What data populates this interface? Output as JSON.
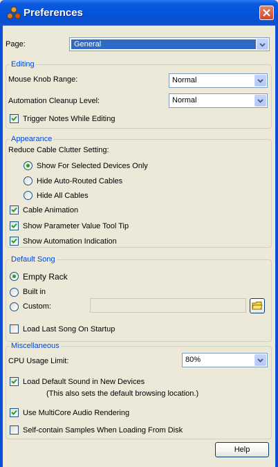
{
  "window": {
    "title": "Preferences",
    "icon": "app-logo-icon",
    "close_icon": "close-icon"
  },
  "page": {
    "label": "Page:",
    "selected": "General"
  },
  "editing": {
    "legend": "Editing",
    "mouse_knob_label": "Mouse Knob Range:",
    "mouse_knob_value": "Normal",
    "automation_label": "Automation Cleanup Level:",
    "automation_value": "Normal",
    "trigger_notes_label": "Trigger Notes While Editing",
    "trigger_notes_checked": true
  },
  "appearance": {
    "legend": "Appearance",
    "cable_clutter_label": "Reduce Cable Clutter Setting:",
    "radios": [
      {
        "label": "Show For Selected Devices Only",
        "selected": true
      },
      {
        "label": "Hide Auto-Routed Cables",
        "selected": false
      },
      {
        "label": "Hide All Cables",
        "selected": false
      }
    ],
    "checkboxes": [
      {
        "label": "Cable Animation",
        "checked": true
      },
      {
        "label": "Show Parameter Value Tool Tip",
        "checked": true
      },
      {
        "label": "Show Automation Indication",
        "checked": true
      }
    ]
  },
  "default_song": {
    "legend": "Default Song",
    "radios": [
      {
        "label": "Empty Rack",
        "selected": true
      },
      {
        "label": "Built in",
        "selected": false
      },
      {
        "label": "Custom:",
        "selected": false
      }
    ],
    "custom_value": "",
    "browse_icon": "folder-icon",
    "load_last_label": "Load Last Song On Startup",
    "load_last_checked": false
  },
  "misc": {
    "legend": "Miscellaneous",
    "cpu_label": "CPU Usage Limit:",
    "cpu_value": "80%",
    "load_default_sound_label": "Load Default Sound in New Devices",
    "load_default_sound_checked": true,
    "load_default_sound_note": "(This also sets the default browsing location.)",
    "multicore_label": "Use MultiCore Audio Rendering",
    "multicore_checked": true,
    "self_contain_label": "Self-contain Samples When Loading From Disk",
    "self_contain_checked": false
  },
  "help_label": "Help"
}
